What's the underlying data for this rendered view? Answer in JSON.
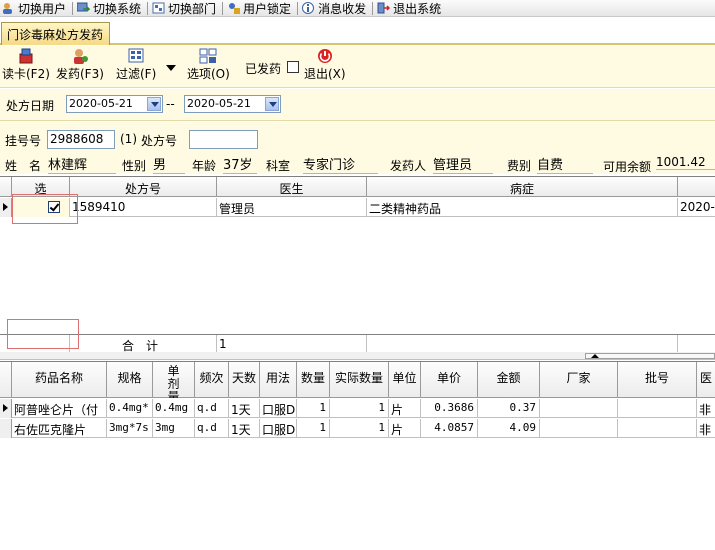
{
  "menu": [
    {
      "label": "切换用户",
      "icon": "switch-user-icon"
    },
    {
      "label": "切换系统",
      "icon": "switch-system-icon"
    },
    {
      "label": "切换部门",
      "icon": "switch-department-icon"
    },
    {
      "label": "用户锁定",
      "icon": "user-lock-icon"
    },
    {
      "label": "消息收发",
      "icon": "message-icon"
    },
    {
      "label": "退出系统",
      "icon": "exit-system-icon"
    }
  ],
  "tab": {
    "label": "门诊毒麻处方发药"
  },
  "toolbar": {
    "read_card": "读卡(F2)",
    "dispense": "发药(F3)",
    "filter": "过滤(F)",
    "options": "选项(O)",
    "dispensed_label": "已发药",
    "exit": "退出(X)"
  },
  "date_filter": {
    "label": "处方日期",
    "from": "2020-05-21",
    "separator": "--",
    "to": "2020-05-21"
  },
  "patient": {
    "reg_no_label": "挂号号",
    "reg_no": "2988608",
    "count": "(1)",
    "rx_no_label": "处方号",
    "rx_no": "",
    "name_label": "姓　名",
    "name": "林建辉",
    "gender_label": "性别",
    "gender": "男",
    "age_label": "年龄",
    "age": "37岁",
    "dept_label": "科室",
    "dept": "专家门诊",
    "dispenser_label": "发药人",
    "dispenser": "管理员",
    "fee_type_label": "费别",
    "fee_type": "自费",
    "balance_label": "可用余额",
    "balance": "1001.42"
  },
  "prescriptions": {
    "columns": [
      "选",
      "处方号",
      "医生",
      "病症"
    ],
    "rows": [
      {
        "selected": true,
        "rx_no": "1589410",
        "doctor": "管理员",
        "diagnosis": "二类精神药品",
        "date": "2020-0"
      }
    ],
    "total_label": "合　计",
    "total_value": "1"
  },
  "drugs": {
    "columns": [
      "药品名称",
      "规格",
      "单剂量",
      "频次",
      "天数",
      "用法",
      "数量",
      "实际数量",
      "单位",
      "单价",
      "金额",
      "厂家",
      "批号",
      "医"
    ],
    "rows": [
      {
        "name": "阿普唑仑片（付",
        "spec": "0.4mg*",
        "dose": "0.4mg",
        "freq": "q.d",
        "days": "1天",
        "usage": "口服D",
        "qty": "1",
        "actual_qty": "1",
        "unit": "片",
        "price": "0.3686",
        "amount": "0.37",
        "maker": "",
        "batch": "",
        "doc": "非"
      },
      {
        "name": "右佐匹克隆片",
        "spec": "3mg*7s",
        "dose": "3mg",
        "freq": "q.d",
        "days": "1天",
        "usage": "口服D",
        "qty": "1",
        "actual_qty": "1",
        "unit": "片",
        "price": "4.0857",
        "amount": "4.09",
        "maker": "",
        "batch": "",
        "doc": "非"
      }
    ]
  }
}
